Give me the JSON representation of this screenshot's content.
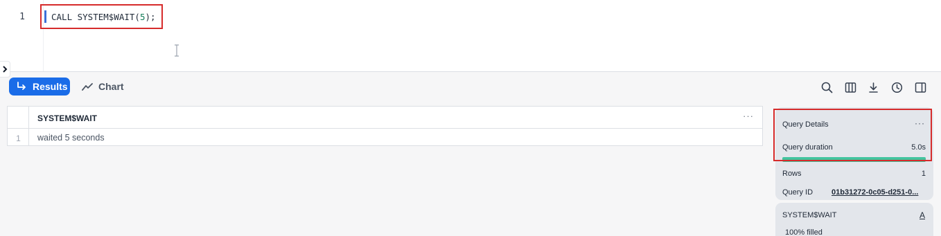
{
  "editor": {
    "line_number": "1",
    "code_prefix": "CALL SYSTEM$WAIT(",
    "code_arg": "5",
    "code_suffix": ");"
  },
  "toolbar": {
    "results_label": "Results",
    "chart_label": "Chart",
    "icons": [
      "search-icon",
      "columns-icon",
      "download-icon",
      "history-icon",
      "split-panel-icon"
    ],
    "accent_color": "#1a6ce8"
  },
  "grid": {
    "columns": [
      "SYSTEM$WAIT"
    ],
    "rows": [
      {
        "row_number": "1",
        "values": [
          "waited 5 seconds"
        ]
      }
    ],
    "column_menu": "···"
  },
  "query_details": {
    "title": "Query Details",
    "menu": "···",
    "duration_label": "Query duration",
    "duration_value": "5.0s",
    "duration_fill_fraction": 1.0,
    "duration_bar_color": "#43c49e",
    "rows_label": "Rows",
    "rows_value": "1",
    "query_id_label": "Query ID",
    "query_id_value": "01b31272-0c05-d251-0..."
  },
  "column_card": {
    "title": "SYSTEM$WAIT",
    "type_glyph": "A",
    "filled_text": "100% filled"
  },
  "highlight_color": "#d62b2b"
}
